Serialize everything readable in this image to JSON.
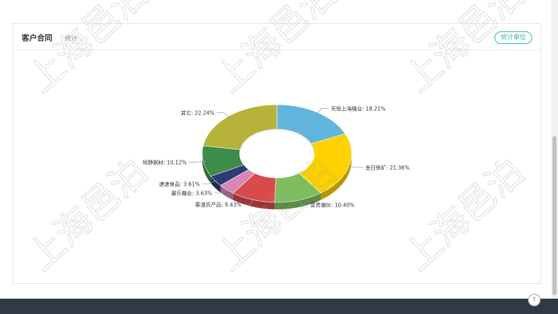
{
  "panel": {
    "title": "客户合同",
    "subtitle": "统计...",
    "unit_button": "统计单位"
  },
  "chart_data": {
    "type": "pie",
    "donut": true,
    "slices": [
      {
        "label": "天恒上海桶业",
        "value": 18.21,
        "display": "天恒上海桶业: 18.21%",
        "color": "#62b5dd"
      },
      {
        "label": "金日铁矿",
        "value": 21.36,
        "display": "金日铁矿: 21.36%",
        "color": "#fdd200"
      },
      {
        "label": "富贵塘伙",
        "value": 10.4,
        "display": "富贵塘伙: 10.40%",
        "color": "#7dbf5b"
      },
      {
        "label": "雾温农产品",
        "value": 9.43,
        "display": "雾温农产品: 9.43%",
        "color": "#d84b4b"
      },
      {
        "label": "最乐糖业",
        "value": 3.63,
        "display": "最乐糖业: 3.63%",
        "color": "#d886b9"
      },
      {
        "label": "速速食品",
        "value": 3.61,
        "display": "速速食品: 3.61%",
        "color": "#2b3b73"
      },
      {
        "label": "恒静钢材",
        "value": 10.12,
        "display": "恒静钢材: 10.12%",
        "color": "#3e8c49"
      },
      {
        "label": "其它",
        "value": 22.24,
        "display": "其它: 22.24%",
        "color": "#b6b23a"
      }
    ]
  },
  "watermark": "上海邑泊",
  "back_top_icon": "arrow-up-icon",
  "back_top_glyph": "↑"
}
